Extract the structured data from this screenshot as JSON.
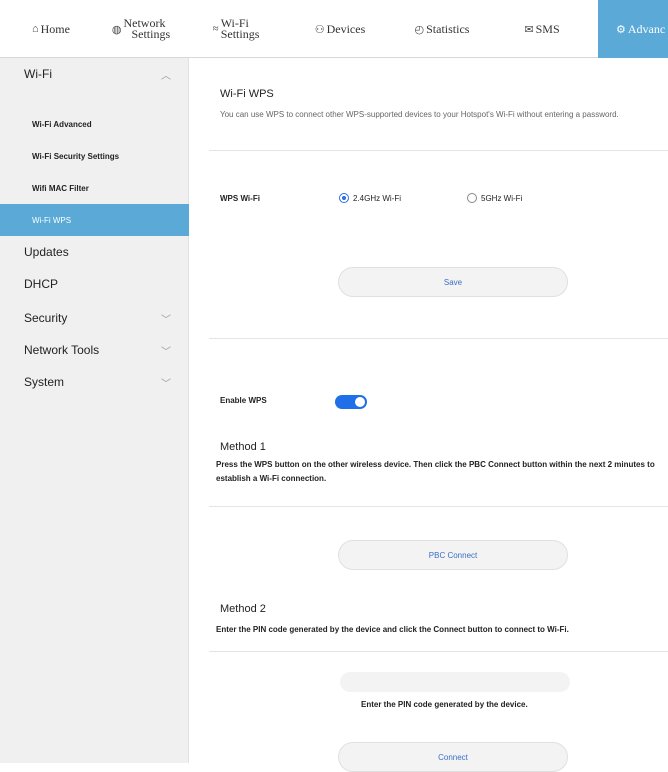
{
  "nav": {
    "items": [
      {
        "icon": "⌂",
        "label": "Home"
      },
      {
        "icon": "◍",
        "label": "Network",
        "label2": "Settings"
      },
      {
        "icon": "≈",
        "label": "Wi-Fi",
        "label2": "Settings"
      },
      {
        "icon": "⚇",
        "label": "Devices"
      },
      {
        "icon": "◴",
        "label": "Statistics"
      },
      {
        "icon": "✉",
        "label": "SMS"
      },
      {
        "icon": "⚙",
        "label": "Advanc"
      }
    ],
    "active_color": "#5aa9d6"
  },
  "sidebar": {
    "wifi": "Wi-Fi",
    "wifi_sub": [
      "Wi-Fi Advanced",
      "Wi-Fi Security Settings",
      "Wifi MAC Filter",
      "Wi-Fi WPS"
    ],
    "updates": "Updates",
    "dhcp": "DHCP",
    "security": "Security",
    "network_tools": "Network Tools",
    "system": "System"
  },
  "main": {
    "title": "Wi-Fi WPS",
    "description": "You can use WPS to connect other WPS-supported devices to your Hotspot's Wi-Fi without entering a password.",
    "wps_wifi_label": "WPS Wi-Fi",
    "radio_24": "2.4GHz Wi-Fi",
    "radio_5": "5GHz Wi-Fi",
    "radio_selected": "2.4GHz Wi-Fi",
    "save_label": "Save",
    "enable_wps_label": "Enable WPS",
    "enable_wps_on": true,
    "method1_title": "Method 1",
    "method1_desc": "Press the WPS button on the other wireless device. Then click the PBC Connect button within the next 2 minutes to establish a Wi-Fi connection.",
    "pbc_label": "PBC Connect",
    "method2_title": "Method 2",
    "method2_desc": "Enter the PIN code generated by the device and click the Connect button to connect to Wi-Fi.",
    "pin_value": "",
    "pin_hint": "Enter the PIN code generated by the device.",
    "connect_label": "Connect"
  }
}
